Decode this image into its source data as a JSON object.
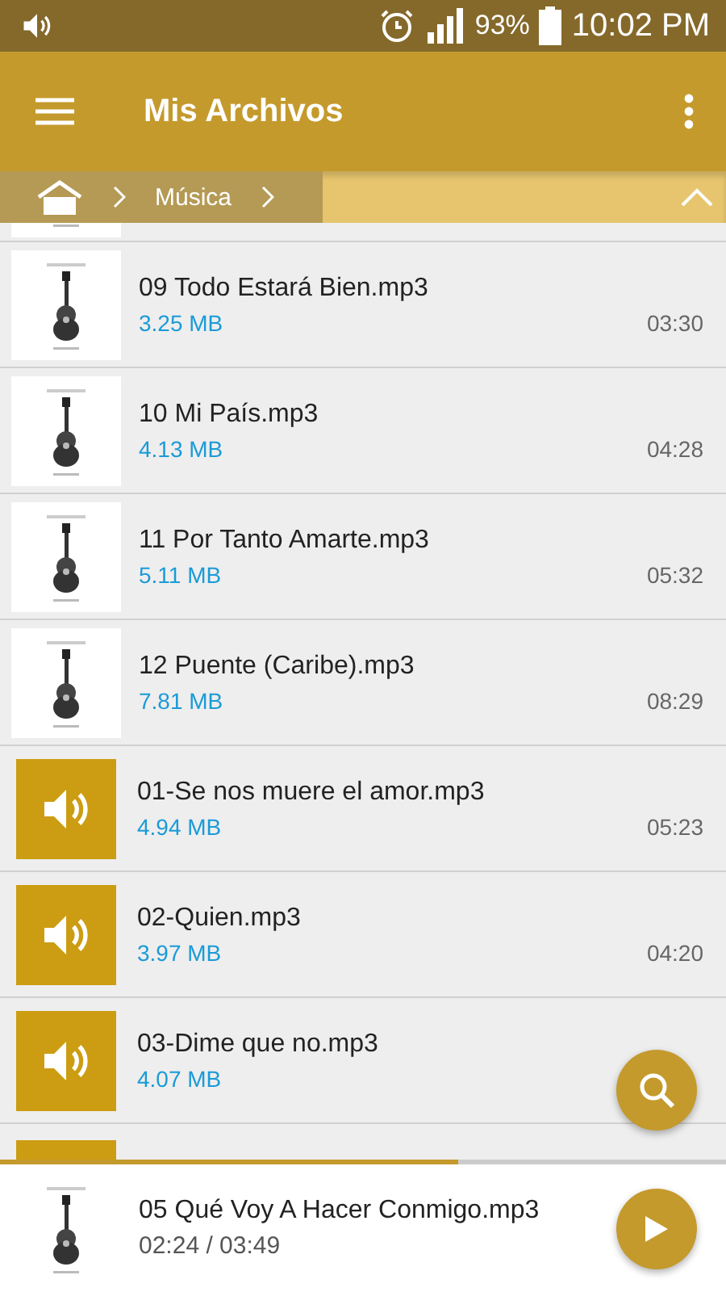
{
  "status_bar": {
    "battery": "93%",
    "time": "10:02 PM"
  },
  "app_bar": {
    "title": "Mis Archivos"
  },
  "breadcrumb": {
    "items": [
      "Música"
    ]
  },
  "files": [
    {
      "kind": "album",
      "cut_off": true
    },
    {
      "kind": "album",
      "name": "09 Todo Estará Bien.mp3",
      "size": "3.25 MB",
      "duration": "03:30"
    },
    {
      "kind": "album",
      "name": "10 Mi País.mp3",
      "size": "4.13 MB",
      "duration": "04:28"
    },
    {
      "kind": "album",
      "name": "11 Por Tanto Amarte.mp3",
      "size": "5.11 MB",
      "duration": "05:32"
    },
    {
      "kind": "album",
      "name": "12 Puente (Caribe).mp3",
      "size": "7.81 MB",
      "duration": "08:29"
    },
    {
      "kind": "audio",
      "name": "01-Se nos muere el amor.mp3",
      "size": "4.94 MB",
      "duration": "05:23"
    },
    {
      "kind": "audio",
      "name": "02-Quien.mp3",
      "size": "3.97 MB",
      "duration": "04:20"
    },
    {
      "kind": "audio",
      "name": "03-Dime que no.mp3",
      "size": "4.07 MB"
    },
    {
      "kind": "audio",
      "cut_off": true
    }
  ],
  "player": {
    "title": "05 Qué Voy A Hacer Conmigo.mp3",
    "time": "02:24 / 03:49",
    "level": 0.63
  }
}
